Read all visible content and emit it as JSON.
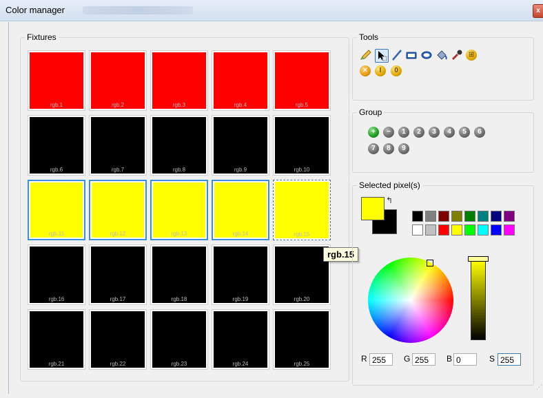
{
  "window": {
    "title": "Color manager",
    "close_label": "x"
  },
  "fixtures": {
    "legend": "Fixtures",
    "cells": [
      {
        "label": "rgb.1",
        "color": "#ff0000"
      },
      {
        "label": "rgb.2",
        "color": "#ff0000"
      },
      {
        "label": "rgb.3",
        "color": "#ff0000"
      },
      {
        "label": "rgb.4",
        "color": "#ff0000"
      },
      {
        "label": "rgb.5",
        "color": "#ff0000"
      },
      {
        "label": "rgb.6",
        "color": "#000000"
      },
      {
        "label": "rgb.7",
        "color": "#000000"
      },
      {
        "label": "rgb.8",
        "color": "#000000"
      },
      {
        "label": "rgb.9",
        "color": "#000000"
      },
      {
        "label": "rgb.10",
        "color": "#000000"
      },
      {
        "label": "rgb.11",
        "color": "#ffff00",
        "state": "selected"
      },
      {
        "label": "rgb.12",
        "color": "#ffff00",
        "state": "selected"
      },
      {
        "label": "rgb.13",
        "color": "#ffff00",
        "state": "selected"
      },
      {
        "label": "rgb.14",
        "color": "#ffff00",
        "state": "selected"
      },
      {
        "label": "rgb.15",
        "color": "#ffff00",
        "state": "hover"
      },
      {
        "label": "rgb.16",
        "color": "#000000"
      },
      {
        "label": "rgb.17",
        "color": "#000000"
      },
      {
        "label": "rgb.18",
        "color": "#000000"
      },
      {
        "label": "rgb.19",
        "color": "#000000"
      },
      {
        "label": "rgb.20",
        "color": "#000000"
      },
      {
        "label": "rgb.21",
        "color": "#000000"
      },
      {
        "label": "rgb.22",
        "color": "#000000"
      },
      {
        "label": "rgb.23",
        "color": "#000000"
      },
      {
        "label": "rgb.24",
        "color": "#000000"
      },
      {
        "label": "rgb.25",
        "color": "#000000"
      }
    ],
    "tooltip": "rgb.15"
  },
  "tools": {
    "legend": "Tools",
    "items": [
      {
        "name": "pencil-icon",
        "active": false
      },
      {
        "name": "select-arrow-icon",
        "active": true
      },
      {
        "name": "line-icon",
        "active": false
      },
      {
        "name": "rectangle-icon",
        "active": false
      },
      {
        "name": "ellipse-icon",
        "active": false
      },
      {
        "name": "fill-bucket-icon",
        "active": false
      },
      {
        "name": "eyedropper-icon",
        "active": false
      },
      {
        "name": "grid-icon",
        "active": false
      },
      {
        "name": "clear-icon",
        "active": false
      },
      {
        "name": "invert-icon",
        "active": false
      },
      {
        "name": "zero-icon",
        "active": false
      }
    ],
    "glyphs": {
      "grid": "⊞",
      "clear": "✕",
      "invert": "I",
      "zero": "0"
    }
  },
  "group": {
    "legend": "Group",
    "buttons": [
      "+",
      "−",
      "1",
      "2",
      "3",
      "4",
      "5",
      "6",
      "7",
      "8",
      "9"
    ]
  },
  "pixels": {
    "legend": "Selected pixel(s)",
    "primary_color": "#ffff00",
    "secondary_color": "#000000",
    "swap_glyph": "↰",
    "palette": [
      "#000000",
      "#808080",
      "#800000",
      "#808000",
      "#008000",
      "#008080",
      "#000080",
      "#800080",
      "#ffffff",
      "#c0c0c0",
      "#ff0000",
      "#ffff00",
      "#00ff00",
      "#00ffff",
      "#0000ff",
      "#ff00ff"
    ],
    "r_label": "R",
    "g_label": "G",
    "b_label": "B",
    "s_label": "S",
    "r": "255",
    "g": "255",
    "b": "0",
    "s": "255",
    "brightness_level": 1.0
  }
}
